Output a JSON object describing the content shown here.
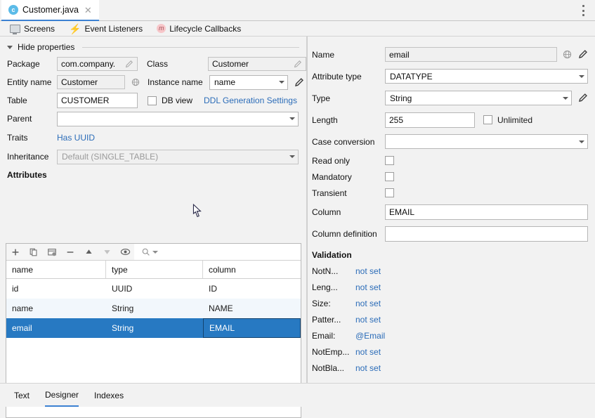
{
  "window": {
    "tab_title": "Customer.java",
    "tab_icon": "class-file-icon",
    "close_icon": "close-icon",
    "more_icon": "more-options-icon"
  },
  "nav": {
    "items": [
      {
        "label": "Screens",
        "icon": "screen-icon"
      },
      {
        "label": "Event Listeners",
        "icon": "lightning-bolt-icon"
      },
      {
        "label": "Lifecycle Callbacks",
        "icon": "method-circle-icon"
      }
    ]
  },
  "entity": {
    "section_label": "Hide properties",
    "package": {
      "label": "Package",
      "value": "com.company.",
      "edit_icon": "pencil-icon"
    },
    "class": {
      "label": "Class",
      "value": "Customer",
      "edit_icon": "pencil-icon"
    },
    "entity_name": {
      "label": "Entity name",
      "value": "Customer",
      "globe_icon": "globe-icon"
    },
    "instance_name": {
      "label": "Instance name",
      "value": "name",
      "edit_icon": "pencil-icon"
    },
    "table": {
      "label": "Table",
      "value": "CUSTOMER"
    },
    "db_view": {
      "label": "DB view",
      "checked": false
    },
    "ddl_link": "DDL Generation Settings",
    "parent": {
      "label": "Parent",
      "value": ""
    },
    "traits": {
      "label": "Traits",
      "value": "Has UUID"
    },
    "inheritance": {
      "label": "Inheritance",
      "value": "Default (SINGLE_TABLE)"
    }
  },
  "attributes": {
    "title": "Attributes",
    "toolbar": [
      {
        "name": "add-attribute-button",
        "glyph": "+"
      },
      {
        "name": "copy-attribute-button",
        "glyph": "copy"
      },
      {
        "name": "generate-attribute-button",
        "glyph": "generate"
      },
      {
        "name": "remove-attribute-button",
        "glyph": "−"
      },
      {
        "name": "move-up-button",
        "glyph": "up"
      },
      {
        "name": "move-down-button",
        "glyph": "down"
      },
      {
        "name": "preview-button",
        "glyph": "eye"
      }
    ],
    "search_placeholder": "",
    "columns": [
      "name",
      "type",
      "column"
    ],
    "rows": [
      {
        "name": "id",
        "type": "UUID",
        "column": "ID",
        "selected": false
      },
      {
        "name": "name",
        "type": "String",
        "column": "NAME",
        "selected": false
      },
      {
        "name": "email",
        "type": "String",
        "column": "EMAIL",
        "selected": true
      }
    ]
  },
  "inspector": {
    "name": {
      "label": "Name",
      "value": "email",
      "globe_icon": "globe-icon",
      "edit_icon": "pencil-icon"
    },
    "attribute_type": {
      "label": "Attribute type",
      "value": "DATATYPE"
    },
    "type": {
      "label": "Type",
      "value": "String",
      "edit_icon": "pencil-icon"
    },
    "length": {
      "label": "Length",
      "value": "255"
    },
    "unlimited": {
      "label": "Unlimited",
      "checked": false
    },
    "case_conversion": {
      "label": "Case conversion",
      "value": ""
    },
    "read_only": {
      "label": "Read only",
      "checked": false
    },
    "mandatory": {
      "label": "Mandatory",
      "checked": false
    },
    "transient": {
      "label": "Transient",
      "checked": false
    },
    "column": {
      "label": "Column",
      "value": "EMAIL"
    },
    "column_definition": {
      "label": "Column definition",
      "value": ""
    }
  },
  "validation": {
    "title": "Validation",
    "items": [
      {
        "label": "NotN...",
        "value": "not set"
      },
      {
        "label": "Leng...",
        "value": "not set"
      },
      {
        "label": "Size:",
        "value": "not set"
      },
      {
        "label": "Patter...",
        "value": "not set"
      },
      {
        "label": "Email:",
        "value": "@Email"
      },
      {
        "label": "NotEmp...",
        "value": "not set"
      },
      {
        "label": "NotBla...",
        "value": "not set"
      }
    ]
  },
  "bottom_tabs": [
    {
      "label": "Text",
      "active": false
    },
    {
      "label": "Designer",
      "active": true
    },
    {
      "label": "Indexes",
      "active": false
    }
  ],
  "colors": {
    "accent": "#3c81d2",
    "selection": "#2779c2",
    "link": "#2b6cb8",
    "background": "#f2f2f2"
  }
}
